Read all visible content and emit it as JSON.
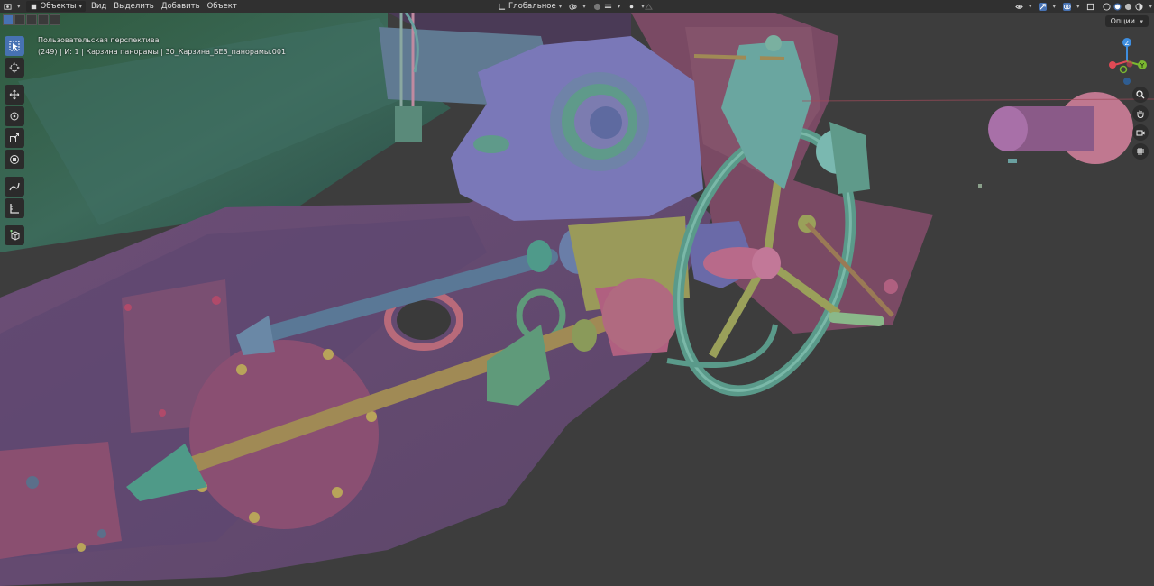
{
  "header": {
    "mode_label": "Объекты",
    "menus": [
      "Вид",
      "Выделить",
      "Добавить",
      "Объект"
    ],
    "orientation_label": "Глобальное"
  },
  "viewport": {
    "view_name": "Пользовательская перспектива",
    "object_info": "(249) | И: 1 | Карзина панорамы | 30_Карзина_БЕЗ_панорамы.001",
    "options_label": "Опции"
  },
  "gizmo": {
    "z_label": "Z",
    "y_label": "Y"
  },
  "colors": {
    "accent": "#4772b3",
    "header_bg": "#303030",
    "viewport_bg": "#3d3d3d",
    "axis_x": "#e04a55",
    "axis_y": "#7ab830",
    "axis_z": "#3e8ee0"
  },
  "icons": [
    "editor-type-icon",
    "object-mode-icon",
    "transform-orientation-icon",
    "pivot-icon",
    "snap-icon",
    "proportional-edit-icon",
    "visibility-icon",
    "gizmo-icon",
    "overlay-icon",
    "xray-icon",
    "shading-solid-icon",
    "select-tool-icon",
    "cursor-tool-icon",
    "move-tool-icon",
    "rotate-tool-icon",
    "scale-tool-icon",
    "transform-tool-icon",
    "annotate-tool-icon",
    "measure-tool-icon",
    "add-cube-tool-icon",
    "zoom-icon",
    "pan-hand-icon",
    "camera-icon",
    "grid-view-icon"
  ]
}
